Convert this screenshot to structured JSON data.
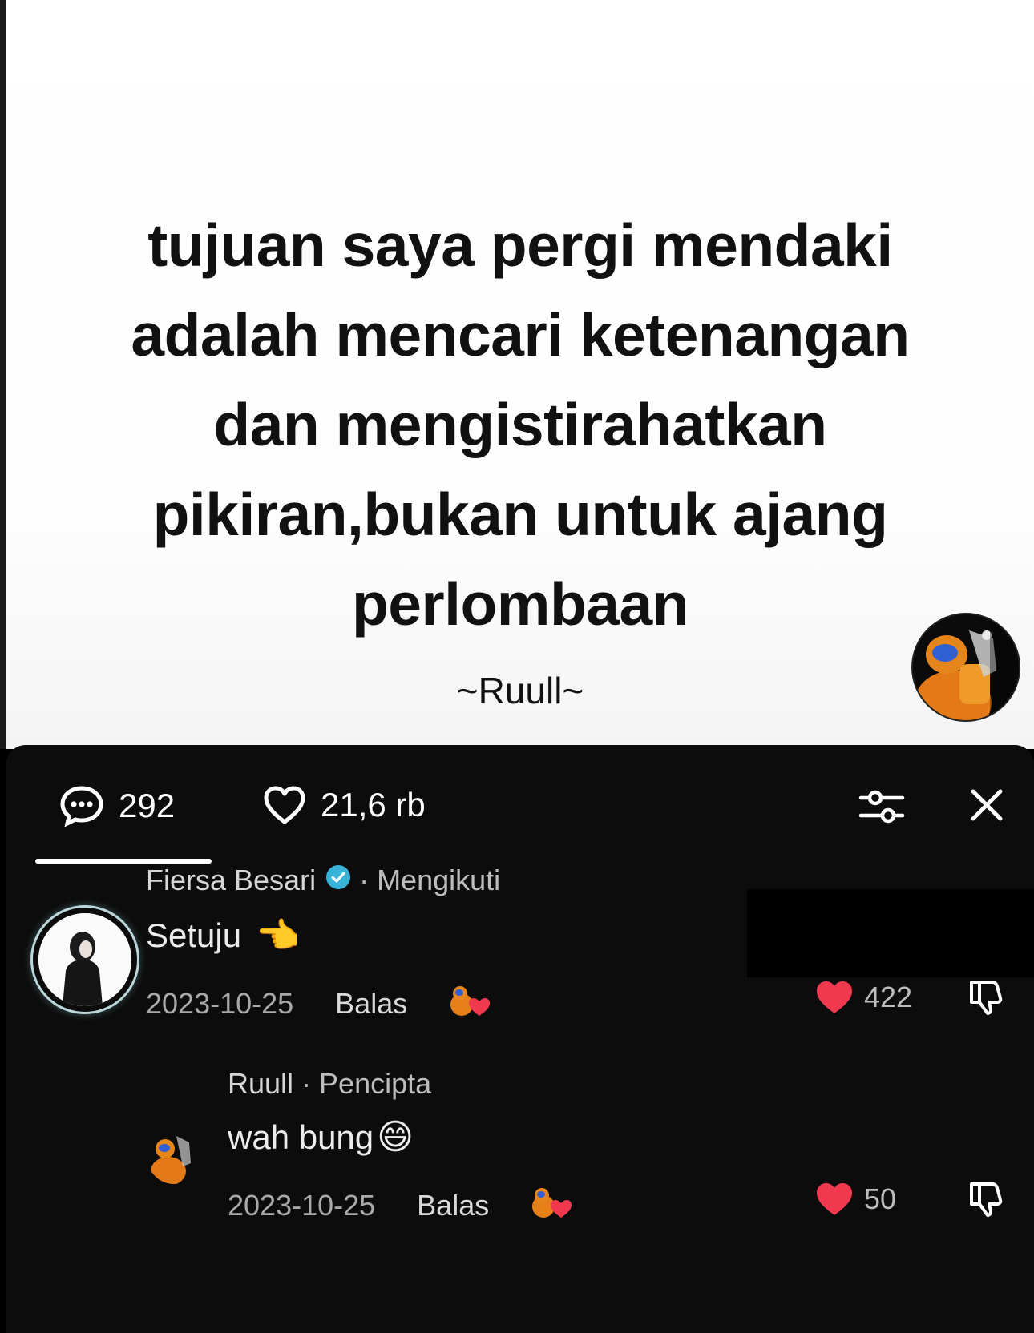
{
  "post": {
    "quote_lines": [
      "tujuan saya pergi mendaki",
      "adalah mencari ketenangan",
      "dan mengistirahatkan",
      "pikiran,bukan untuk ajang",
      "perlombaan"
    ],
    "signature": "~Ruull~"
  },
  "panel": {
    "comment_count": "292",
    "like_count": "21,6 rb",
    "icons": {
      "comments": "chat-bubble-icon",
      "likes": "heart-outline-icon",
      "filter": "sliders-icon",
      "close": "close-icon"
    }
  },
  "comments": [
    {
      "user": "Fiersa Besari",
      "verified": true,
      "tag": "Mengikuti",
      "text": "Setuju",
      "emoji": "👈",
      "date": "2023-10-25",
      "reply_label": "Balas",
      "likes": "422"
    }
  ],
  "reply": {
    "user": "Ruull",
    "tag": "Pencipta",
    "text": "wah bung",
    "emoji": "😄",
    "date": "2023-10-25",
    "reply_label": "Balas",
    "likes": "50"
  },
  "colors": {
    "heart": "#f0394f",
    "verified": "#37b3d8",
    "panel_bg": "#0c0c0c",
    "avatar_ring": "#bcd7da"
  }
}
